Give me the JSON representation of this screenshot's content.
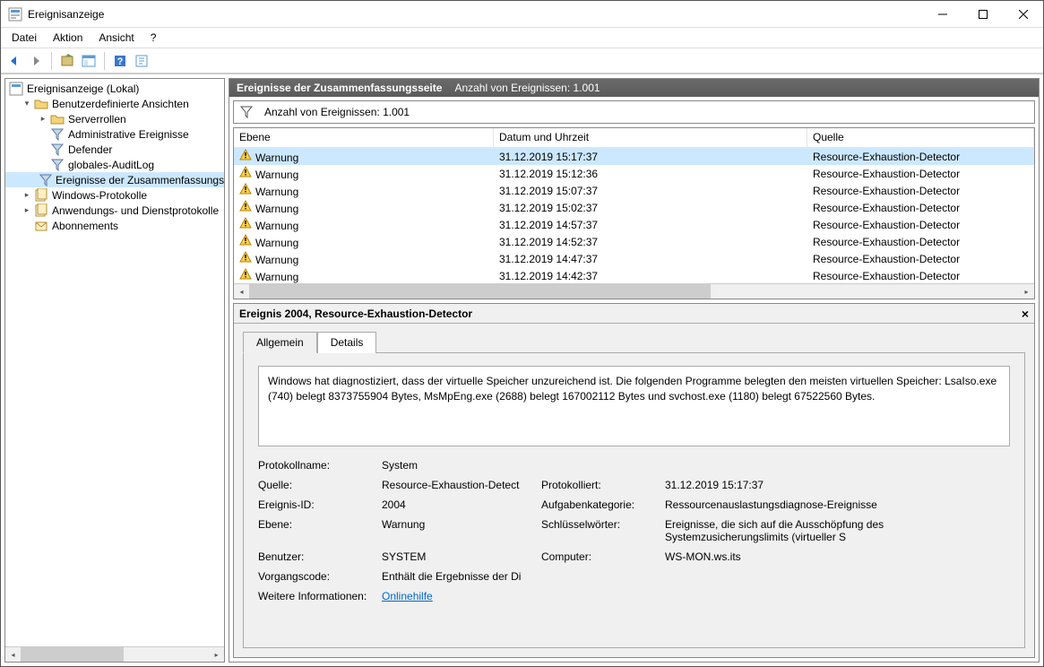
{
  "window": {
    "title": "Ereignisanzeige"
  },
  "menu": {
    "file": "Datei",
    "action": "Aktion",
    "view": "Ansicht",
    "help": "?"
  },
  "tree": {
    "root": "Ereignisanzeige (Lokal)",
    "custom_views": "Benutzerdefinierte Ansichten",
    "server_roles": "Serverrollen",
    "admin_events": "Administrative Ereignisse",
    "defender": "Defender",
    "global_audit": "globales-AuditLog",
    "summary_events": "Ereignisse der Zusammenfassungsseite",
    "windows_logs": "Windows-Protokolle",
    "app_service_logs": "Anwendungs- und Dienstprotokolle",
    "subscriptions": "Abonnements"
  },
  "panel": {
    "title": "Ereignisse der Zusammenfassungsseite",
    "count_label": "Anzahl von Ereignissen: 1.001"
  },
  "filter": {
    "count_label": "Anzahl von Ereignissen: 1.001"
  },
  "columns": {
    "level": "Ebene",
    "datetime": "Datum und Uhrzeit",
    "source": "Quelle"
  },
  "rows": [
    {
      "level": "Warnung",
      "datetime": "31.12.2019 15:17:37",
      "source": "Resource-Exhaustion-Detector"
    },
    {
      "level": "Warnung",
      "datetime": "31.12.2019 15:12:36",
      "source": "Resource-Exhaustion-Detector"
    },
    {
      "level": "Warnung",
      "datetime": "31.12.2019 15:07:37",
      "source": "Resource-Exhaustion-Detector"
    },
    {
      "level": "Warnung",
      "datetime": "31.12.2019 15:02:37",
      "source": "Resource-Exhaustion-Detector"
    },
    {
      "level": "Warnung",
      "datetime": "31.12.2019 14:57:37",
      "source": "Resource-Exhaustion-Detector"
    },
    {
      "level": "Warnung",
      "datetime": "31.12.2019 14:52:37",
      "source": "Resource-Exhaustion-Detector"
    },
    {
      "level": "Warnung",
      "datetime": "31.12.2019 14:47:37",
      "source": "Resource-Exhaustion-Detector"
    },
    {
      "level": "Warnung",
      "datetime": "31.12.2019 14:42:37",
      "source": "Resource-Exhaustion-Detector"
    }
  ],
  "detail": {
    "title": "Ereignis 2004, Resource-Exhaustion-Detector",
    "tabs": {
      "general": "Allgemein",
      "details": "Details"
    },
    "description": "Windows hat diagnostiziert, dass der virtuelle Speicher unzureichend ist. Die folgenden Programme belegten den meisten virtuellen Speicher: LsaIso.exe (740) belegt 8373755904 Bytes, MsMpEng.exe (2688) belegt 167002112 Bytes und svchost.exe (1180) belegt 67522560 Bytes.",
    "labels": {
      "log_name": "Protokollname:",
      "source": "Quelle:",
      "logged": "Protokolliert:",
      "event_id": "Ereignis-ID:",
      "task_cat": "Aufgabenkategorie:",
      "level": "Ebene:",
      "keywords": "Schlüsselwörter:",
      "user": "Benutzer:",
      "computer": "Computer:",
      "opcode": "Vorgangscode:",
      "more_info": "Weitere Informationen:"
    },
    "values": {
      "log_name": "System",
      "source": "Resource-Exhaustion-Detect",
      "logged": "31.12.2019 15:17:37",
      "event_id": "2004",
      "task_cat": "Ressourcenauslastungsdiagnose-Ereignisse",
      "level": "Warnung",
      "keywords": "Ereignisse, die sich auf die Ausschöpfung des Systemzusicherungslimits (virtueller S",
      "user": "SYSTEM",
      "computer": "WS-MON.ws.its",
      "opcode": "Enthält die Ergebnisse der Di",
      "online_help": "Onlinehilfe"
    }
  }
}
